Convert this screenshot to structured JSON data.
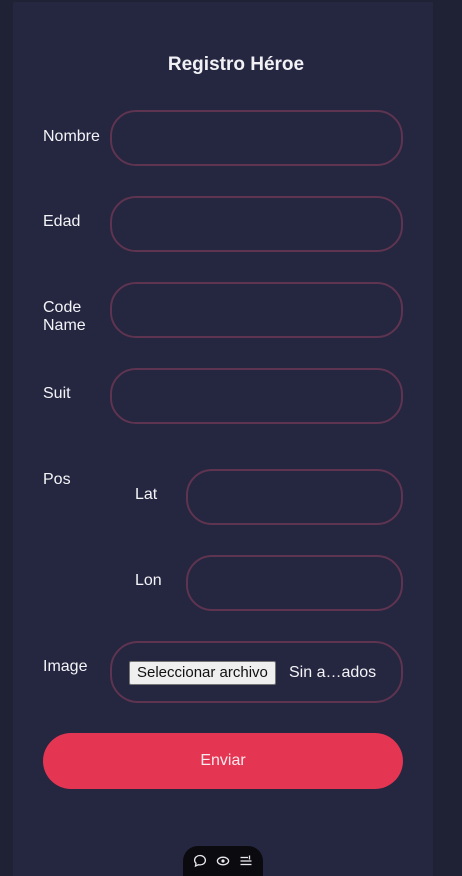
{
  "form": {
    "title": "Registro Héroe",
    "fields": {
      "nombre": {
        "label": "Nombre",
        "value": ""
      },
      "edad": {
        "label": "Edad",
        "value": ""
      },
      "code_name": {
        "label_line1": "Code",
        "label_line2": "Name",
        "value": ""
      },
      "suit": {
        "label": "Suit",
        "value": ""
      },
      "pos": {
        "label": "Pos",
        "lat": {
          "label": "Lat",
          "value": ""
        },
        "lon": {
          "label": "Lon",
          "value": ""
        }
      },
      "image": {
        "label": "Image",
        "button_label": "Seleccionar archivo",
        "status": "Sin a…ados"
      }
    },
    "submit_label": "Enviar"
  },
  "floating_toolbar": {
    "icons": [
      "chat-bubble-icon",
      "eye-icon",
      "list-icon"
    ]
  },
  "colors": {
    "background": "#1f2135",
    "panel": "#252640",
    "field_border": "#5e3450",
    "submit": "#e43552",
    "text": "#f4f4f8"
  }
}
